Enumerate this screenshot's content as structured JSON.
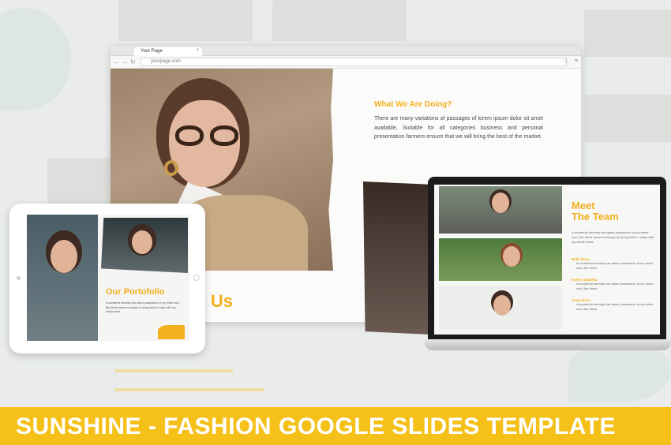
{
  "browser": {
    "tab_title": "Your Page",
    "tab_close": "×",
    "url": "yourpage.com",
    "back_glyph": "←",
    "forward_glyph": "→",
    "reload_glyph": "↻",
    "star_glyph": "☆",
    "menu_glyph": "≡"
  },
  "slide": {
    "what_title": "What We Are Doing?",
    "what_body": "There are many variations of passages of lorem ipsum dolor sit amet available, Suitable for all categories business and personal presentation farmers ensure that we will bring the best of the market.",
    "about_title": "ut Us"
  },
  "laptop": {
    "title_line1": "Meet",
    "title_line2": "The Team",
    "intro": "A wonderful serenity has taken possession of my entire soul, like these sweet mornings of spring which I enjoy with my whole heart.",
    "members": [
      {
        "name": "Bella Bora",
        "text": "A wonderful serenity has taken possession of my entire soul, like these"
      },
      {
        "name": "Evelyn Isabella",
        "text": "A wonderful serenity has taken possession of my entire soul, like these"
      },
      {
        "name": "Avery Bora",
        "text": "A wonderful serenity has taken possession of my entire soul, like these"
      }
    ]
  },
  "tablet": {
    "title": "Our Portofolio",
    "text": "A wonderful serenity has taken possession of my entire soul, like these sweet mornings of spring which I enjoy with my whole heart."
  },
  "banner": {
    "text": "SUNSHINE - FASHION GOOGLE SLIDES TEMPLATE"
  },
  "colors": {
    "accent": "#f2b01e",
    "banner": "#f5c018"
  }
}
